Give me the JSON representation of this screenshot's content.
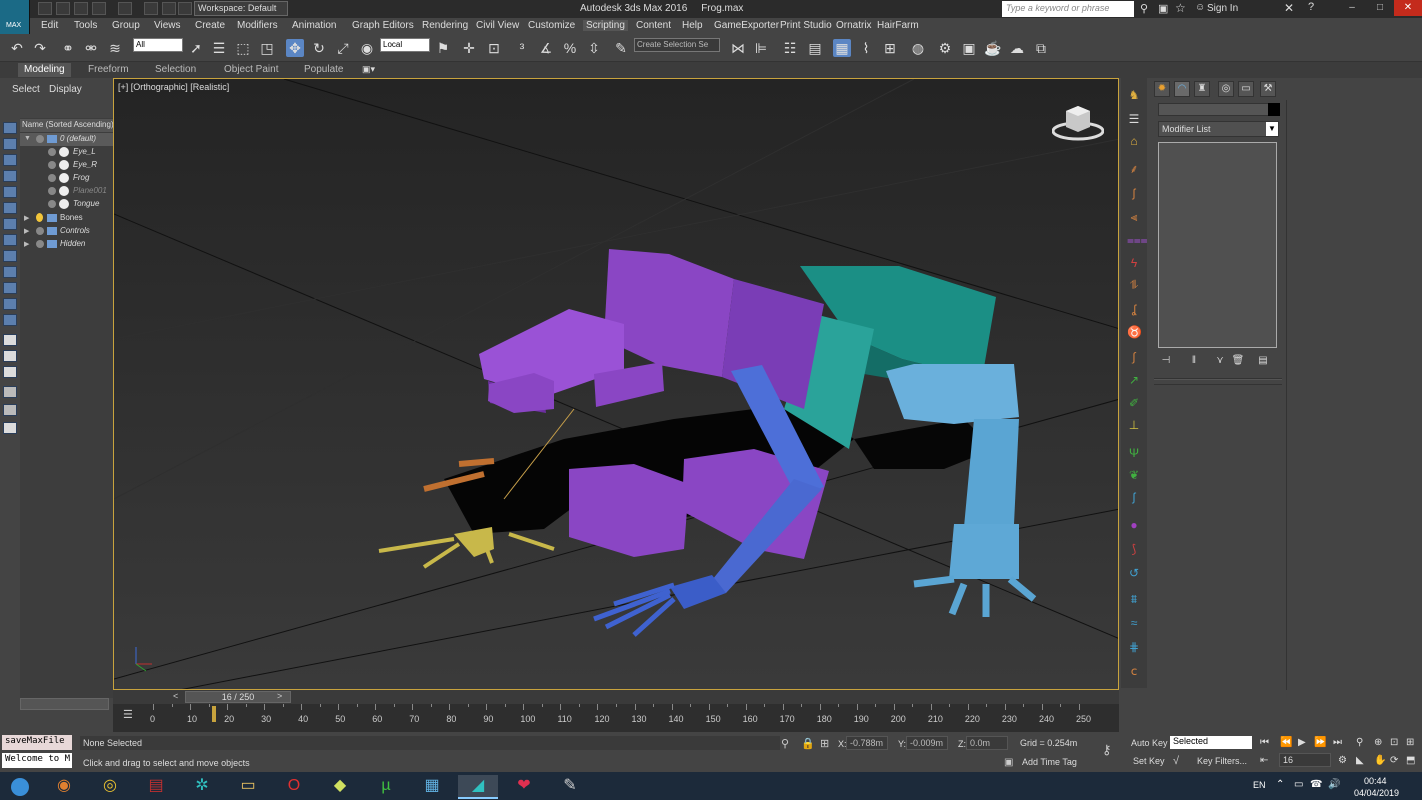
{
  "title_bar": {
    "workspace": "Workspace: Default",
    "app_title": "Autodesk 3ds Max 2016",
    "file_name": "Frog.max",
    "search_placeholder": "Type a keyword or phrase",
    "sign_in": "Sign In",
    "logo_text": "MAX"
  },
  "menu": [
    "Edit",
    "Tools",
    "Group",
    "Views",
    "Create",
    "Modifiers",
    "Animation",
    "Graph Editors",
    "Rendering",
    "Civil View",
    "Customize",
    "Scripting",
    "Content",
    "Help",
    "GameExporter",
    "Print Studio",
    "Ornatrix",
    "HairFarm"
  ],
  "menu_active": "Scripting",
  "toolbar": {
    "selection_filter": "All",
    "ref_coord": "Local",
    "named_selection": "Create Selection Se"
  },
  "ribbon_tabs": [
    "Modeling",
    "Freeform",
    "Selection",
    "Object Paint",
    "Populate"
  ],
  "ribbon_active": "Modeling",
  "explorer": {
    "tabs": [
      "Select",
      "Display"
    ],
    "header": "Name (Sorted Ascending)",
    "rows": [
      {
        "label": "0 (default)",
        "kind": "layer",
        "indent": 0,
        "dim": false
      },
      {
        "label": "Eye_L",
        "kind": "object",
        "indent": 1,
        "dim": false
      },
      {
        "label": "Eye_R",
        "kind": "object",
        "indent": 1,
        "dim": false
      },
      {
        "label": "Frog",
        "kind": "object",
        "indent": 1,
        "dim": false
      },
      {
        "label": "Plane001",
        "kind": "object",
        "indent": 1,
        "dim": true
      },
      {
        "label": "Tongue",
        "kind": "object",
        "indent": 1,
        "dim": false
      },
      {
        "label": "Bones",
        "kind": "layer-bulb",
        "indent": 0,
        "dim": false
      },
      {
        "label": "Controls",
        "kind": "layer",
        "indent": 0,
        "dim": false
      },
      {
        "label": "Hidden",
        "kind": "layer",
        "indent": 0,
        "dim": false
      }
    ]
  },
  "viewport": {
    "label": "[+] [Orthographic] [Realistic]"
  },
  "command_panel": {
    "modifier_list": "Modifier List"
  },
  "timeline": {
    "current_frame": 16,
    "total_frames": 250,
    "slider_label": "16 / 250",
    "ticks": [
      0,
      10,
      20,
      30,
      40,
      50,
      60,
      70,
      80,
      90,
      100,
      110,
      120,
      130,
      140,
      150,
      160,
      170,
      180,
      190,
      200,
      210,
      220,
      230,
      240,
      250
    ]
  },
  "status": {
    "maxscript_listener": "saveMaxFile",
    "maxscript_output": "Welcome to M",
    "selection": "None Selected",
    "prompt": "Click and drag to select and move objects",
    "x": "-0.788m",
    "y": "-0.009m",
    "z": "0.0m",
    "grid": "Grid = 0.254m",
    "add_time_tag": "Add Time Tag",
    "auto_key": "Auto Key",
    "set_key": "Set Key",
    "key_mode": "Selected",
    "key_filters": "Key Filters...",
    "frame": "16"
  },
  "taskbar": {
    "lang": "EN",
    "time": "00:44",
    "date": "04/04/2019"
  }
}
